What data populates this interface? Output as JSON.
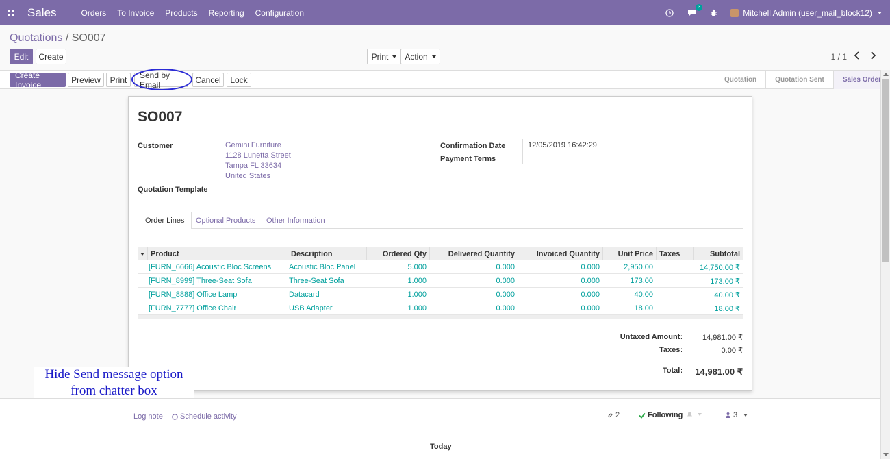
{
  "navbar": {
    "brand": "Sales",
    "menu": [
      "Orders",
      "To Invoice",
      "Products",
      "Reporting",
      "Configuration"
    ],
    "message_count": "3",
    "user": "Mitchell Admin (user_mail_block12)"
  },
  "breadcrumb": {
    "parent": "Quotations",
    "separator": "/",
    "current": "SO007"
  },
  "controls": {
    "edit": "Edit",
    "create": "Create",
    "print": "Print",
    "action": "Action",
    "pager": "1 / 1"
  },
  "actions": {
    "create_invoice": "Create Invoice",
    "preview": "Preview",
    "print": "Print",
    "send_email": "Send by Email",
    "cancel": "Cancel",
    "lock": "Lock"
  },
  "stages": [
    "Quotation",
    "Quotation Sent",
    "Sales Order"
  ],
  "order": {
    "name": "SO007",
    "customer_label": "Customer",
    "customer": [
      "Gemini Furniture",
      "1128 Lunetta Street",
      "Tampa FL 33634",
      "United States"
    ],
    "template_label": "Quotation Template",
    "confirmation_label": "Confirmation Date",
    "confirmation_date": "12/05/2019 16:42:29",
    "payment_terms_label": "Payment Terms"
  },
  "tabs": [
    "Order Lines",
    "Optional Products",
    "Other Information"
  ],
  "table": {
    "headers": [
      "Product",
      "Description",
      "Ordered Qty",
      "Delivered Quantity",
      "Invoiced Quantity",
      "Unit Price",
      "Taxes",
      "Subtotal"
    ],
    "rows": [
      [
        "[FURN_6666] Acoustic Bloc Screens",
        "Acoustic Bloc Panel",
        "5.000",
        "0.000",
        "0.000",
        "2,950.00",
        "",
        "14,750.00 ₹"
      ],
      [
        "[FURN_8999] Three-Seat Sofa",
        "Three-Seat Sofa",
        "1.000",
        "0.000",
        "0.000",
        "173.00",
        "",
        "173.00 ₹"
      ],
      [
        "[FURN_8888] Office Lamp",
        "Datacard",
        "1.000",
        "0.000",
        "0.000",
        "40.00",
        "",
        "40.00 ₹"
      ],
      [
        "[FURN_7777] Office Chair",
        "USB Adapter",
        "1.000",
        "0.000",
        "0.000",
        "18.00",
        "",
        "18.00 ₹"
      ]
    ]
  },
  "totals": {
    "untaxed_label": "Untaxed Amount:",
    "untaxed": "14,981.00 ₹",
    "taxes_label": "Taxes:",
    "taxes": "0.00 ₹",
    "total_label": "Total:",
    "total": "14,981.00 ₹"
  },
  "annotation": {
    "line1": "Hide Send message option",
    "line2": "from chatter box"
  },
  "chatter": {
    "log_note": "Log note",
    "schedule": "Schedule activity",
    "attachments": "2",
    "following": "Following",
    "followers": "3",
    "today": "Today"
  }
}
